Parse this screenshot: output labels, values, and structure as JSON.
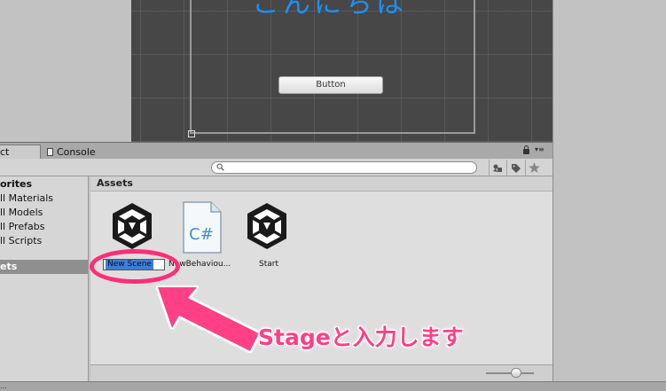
{
  "scene": {
    "canvas_text": "こんにちは",
    "button_label": "Button"
  },
  "tabs": {
    "project_label": "ct",
    "console_label": "Console"
  },
  "toolbar": {
    "search_placeholder": ""
  },
  "sidebar": {
    "favorites_label": "orites",
    "items": [
      {
        "label": "ll Materials"
      },
      {
        "label": "ll Models"
      },
      {
        "label": "ll Prefabs"
      },
      {
        "label": "ll Scripts"
      }
    ],
    "assets_label": "ets"
  },
  "assets": {
    "header": "Assets",
    "items": [
      {
        "label": "New Scene",
        "icon": "unity-scene-icon"
      },
      {
        "label": "NewBehaviou...",
        "icon": "csharp-script-icon"
      },
      {
        "label": "Start",
        "icon": "unity-scene-icon"
      }
    ],
    "script_icon_text": "C#"
  },
  "status_bar": {
    "text": "..."
  },
  "annotation": {
    "text": "Stageと入力します",
    "color": "#ff3f86"
  }
}
